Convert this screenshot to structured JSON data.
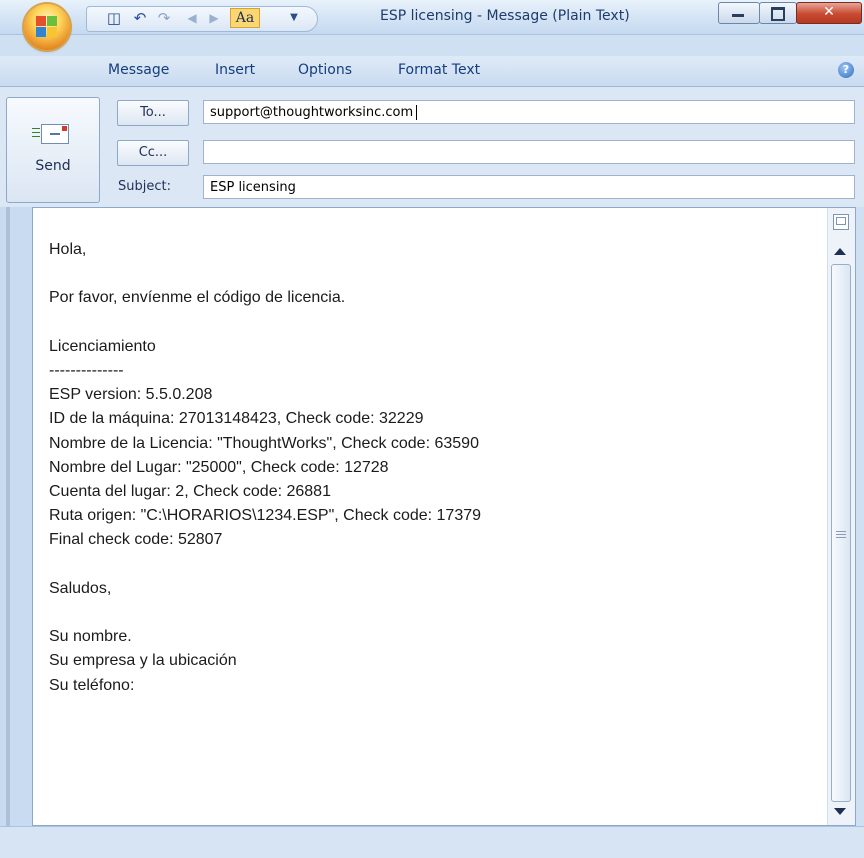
{
  "window": {
    "title": "ESP licensing - Message (Plain Text)"
  },
  "quick_access": {
    "font_button_label": "Aa"
  },
  "ribbon": {
    "tabs": [
      "Message",
      "Insert",
      "Options",
      "Format Text"
    ],
    "help_label": "?"
  },
  "compose": {
    "send_label": "Send",
    "to_button": "To...",
    "cc_button": "Cc...",
    "subject_label": "Subject:",
    "to_value": "support@thoughtworksinc.com",
    "cc_value": "",
    "subject_value": "ESP licensing"
  },
  "body": {
    "text": "Hola,\n\nPor favor, envíenme el código de licencia.\n\nLicenciamiento\n--------------\nESP version: 5.5.0.208\nID de la máquina: 27013148423, Check code: 32229\nNombre de la Licencia: \"ThoughtWorks\", Check code: 63590\nNombre del Lugar: \"25000\", Check code: 12728\nCuenta del lugar: 2, Check code: 26881\nRuta origen: \"C:\\HORARIOS\\1234.ESP\", Check code: 17379\nFinal check code: 52807\n\nSaludos,\n\nSu nombre.\nSu empresa y la ubicación\nSu teléfono:"
  },
  "icons": {
    "office": "office-button-icon",
    "save": "save-icon",
    "undo": "undo-icon",
    "redo": "redo-icon",
    "prev": "previous-item-icon",
    "next": "next-item-icon",
    "customize": "customize-qat-icon",
    "minimize": "minimize-icon",
    "maximize": "maximize-icon",
    "close": "close-icon",
    "send": "send-icon"
  },
  "colors": {
    "ribbon_text": "#153e7e",
    "office_orange": "#e9932a",
    "close_red": "#c74a31",
    "accent_aa": "#fbd772"
  }
}
